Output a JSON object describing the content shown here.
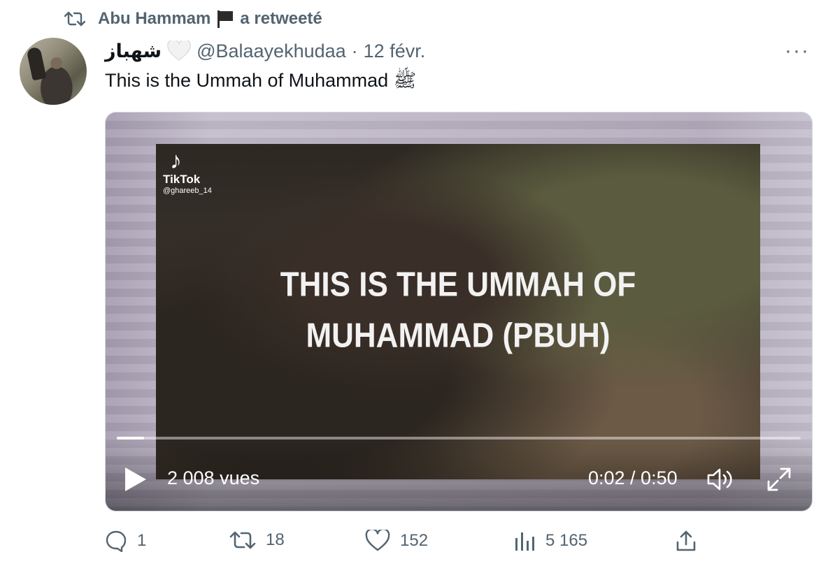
{
  "retweet": {
    "retweeter_name": "Abu Hammam",
    "retweet_text": "a retweeté"
  },
  "tweet": {
    "display_name": "شهباز",
    "handle": "@Balaayekhudaa",
    "separator": "·",
    "date": "12 févr.",
    "more_label": "···",
    "text": "This is the Ummah of Muhammad ﷺ"
  },
  "video": {
    "watermark_brand": "TikTok",
    "watermark_user": "@ghareeb_14",
    "overlay_line1": "THIS IS THE UMMAH OF",
    "overlay_line2": "MUHAMMAD (PBUH)",
    "views": "2 008 vues",
    "time": "0:02 / 0:50",
    "progress_fraction": 0.04
  },
  "actions": {
    "reply_count": "1",
    "retweet_count": "18",
    "like_count": "152",
    "views_count": "5 165"
  },
  "colors": {
    "secondary_text": "#536471",
    "primary_text": "#0f1419"
  }
}
